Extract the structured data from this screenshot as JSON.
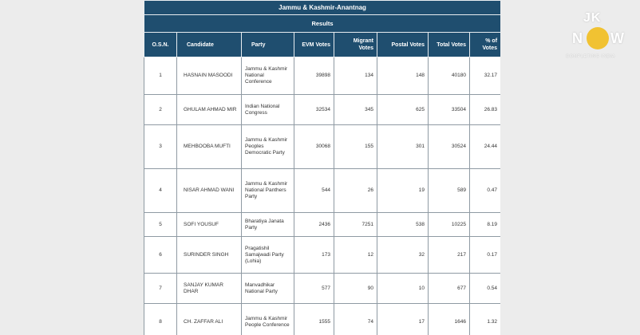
{
  "title": "Jammu & Kashmir-Anantnag",
  "subtitle": "Results",
  "headers": {
    "osn": "O.S.N.",
    "candidate": "Candidate",
    "party": "Party",
    "evm": "EVM Votes",
    "migrant": "Migrant Votes",
    "postal": "Postal Votes",
    "total": "Total Votes",
    "pct": "% of Votes"
  },
  "rows": [
    {
      "osn": "1",
      "candidate": "HASNAIN MASOODI",
      "party": "Jammu & Kashmir National Conference",
      "evm": "39898",
      "migrant": "134",
      "postal": "148",
      "total": "40180",
      "pct": "32.17"
    },
    {
      "osn": "2",
      "candidate": "GHULAM AHMAD MIR",
      "party": "Indian National Congress",
      "evm": "32534",
      "migrant": "345",
      "postal": "625",
      "total": "33504",
      "pct": "26.83"
    },
    {
      "osn": "3",
      "candidate": "MEHBOOBA MUFTI",
      "party": "Jammu & Kashmir Peoples Democratic Party",
      "evm": "30068",
      "migrant": "155",
      "postal": "301",
      "total": "30524",
      "pct": "24.44"
    },
    {
      "osn": "4",
      "candidate": "NISAR AHMAD WANI",
      "party": "Jammu & Kashmir National Panthers Party",
      "evm": "544",
      "migrant": "26",
      "postal": "19",
      "total": "589",
      "pct": "0.47"
    },
    {
      "osn": "5",
      "candidate": "SOFI YOUSUF",
      "party": "Bharatiya Janata Party",
      "evm": "2436",
      "migrant": "7251",
      "postal": "538",
      "total": "10225",
      "pct": "8.19"
    },
    {
      "osn": "6",
      "candidate": "SURINDER SINGH",
      "party": "Pragatishil Samajwadi Party (Lohia)",
      "evm": "173",
      "migrant": "12",
      "postal": "32",
      "total": "217",
      "pct": "0.17"
    },
    {
      "osn": "7",
      "candidate": "SANJAY KUMAR DHAR",
      "party": "Manvadhikar National Party",
      "evm": "577",
      "migrant": "90",
      "postal": "10",
      "total": "677",
      "pct": "0.54"
    },
    {
      "osn": "8",
      "candidate": "CH. ZAFFAR ALI",
      "party": "Jammu & Kashmir People Conference",
      "evm": "1555",
      "migrant": "74",
      "postal": "17",
      "total": "1646",
      "pct": "1.32"
    }
  ],
  "logo": {
    "top": "JK",
    "n": "N",
    "w": "W",
    "tagline": "COMPLETING INDIA",
    "accent": "#f1c232"
  },
  "colors": {
    "header_bg": "#1f4e6f",
    "page_bg": "#ececec"
  }
}
